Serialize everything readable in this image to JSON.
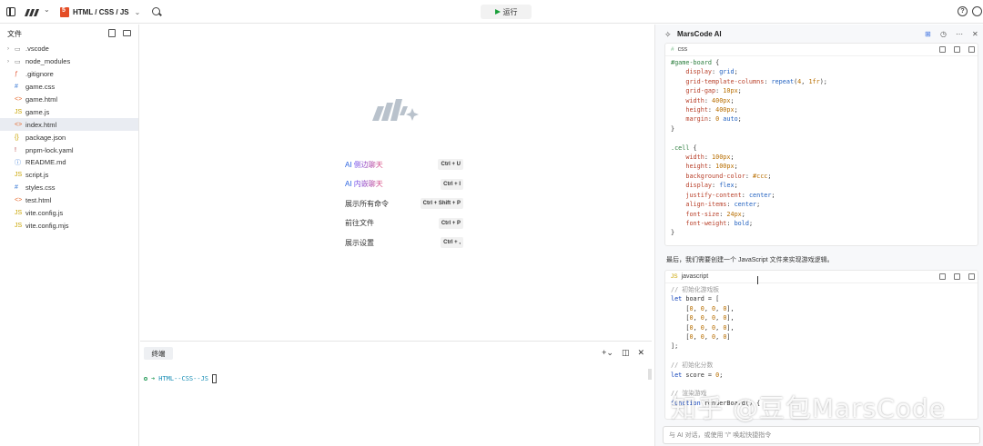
{
  "topbar": {
    "project_name": "HTML / CSS / JS",
    "run_label": "运行",
    "help_glyph": "?"
  },
  "explorer": {
    "title": "文件",
    "items": [
      {
        "name": ".vscode",
        "type": "folder",
        "icon": "folder-icon"
      },
      {
        "name": "node_modules",
        "type": "folder",
        "icon": "folder-icon"
      },
      {
        "name": ".gitignore",
        "type": "file",
        "glyph": "ƒ",
        "color": "#e45b3a"
      },
      {
        "name": "game.css",
        "type": "file",
        "glyph": "#",
        "color": "#3a7bd5"
      },
      {
        "name": "game.html",
        "type": "file",
        "glyph": "<>",
        "color": "#e66b2f"
      },
      {
        "name": "game.js",
        "type": "file",
        "glyph": "JS",
        "color": "#c9a400"
      },
      {
        "name": "index.html",
        "type": "file",
        "glyph": "<>",
        "color": "#e66b2f",
        "active": true
      },
      {
        "name": "package.json",
        "type": "file",
        "glyph": "{}",
        "color": "#c9a400"
      },
      {
        "name": "pnpm-lock.yaml",
        "type": "file",
        "glyph": "!",
        "color": "#b03030"
      },
      {
        "name": "README.md",
        "type": "file",
        "glyph": "ⓘ",
        "color": "#3a7bd5"
      },
      {
        "name": "script.js",
        "type": "file",
        "glyph": "JS",
        "color": "#c9a400"
      },
      {
        "name": "styles.css",
        "type": "file",
        "glyph": "#",
        "color": "#3a7bd5"
      },
      {
        "name": "test.html",
        "type": "file",
        "glyph": "<>",
        "color": "#e66b2f"
      },
      {
        "name": "vite.config.js",
        "type": "file",
        "glyph": "JS",
        "color": "#c9a400"
      },
      {
        "name": "vite.config.mjs",
        "type": "file",
        "glyph": "JS",
        "color": "#c9a400"
      }
    ]
  },
  "shortcuts": [
    {
      "label_prefix": "AI ",
      "label_rest": "侧边聊天",
      "keys": "Ctrl + U"
    },
    {
      "label_prefix": "AI ",
      "label_rest": "内嵌聊天",
      "keys": "Ctrl + I"
    },
    {
      "label_prefix": "",
      "label_rest": "展示所有命令",
      "keys": "Ctrl + Shift + P"
    },
    {
      "label_prefix": "",
      "label_rest": "前往文件",
      "keys": "Ctrl + P"
    },
    {
      "label_prefix": "",
      "label_rest": "展示设置",
      "keys": "Ctrl + ,"
    }
  ],
  "terminal": {
    "tab_label": "终端",
    "prompt_dir": "HTML--CSS--JS"
  },
  "ai_panel": {
    "title": "MarsCode AI",
    "css_card": {
      "lang": "css",
      "code": [
        [
          [
            "#game-board",
            "sel"
          ],
          [
            " {",
            ""
          ]
        ],
        [
          [
            "    display",
            "prop"
          ],
          [
            ": ",
            ""
          ],
          [
            "grid",
            "val"
          ],
          [
            ";",
            ""
          ]
        ],
        [
          [
            "    grid-template-columns",
            "prop"
          ],
          [
            ": ",
            ""
          ],
          [
            "repeat",
            "val"
          ],
          [
            "(",
            ""
          ],
          [
            "4",
            "num"
          ],
          [
            ", ",
            ""
          ],
          [
            "1fr",
            "num"
          ],
          [
            ");",
            ""
          ]
        ],
        [
          [
            "    grid-gap",
            "prop"
          ],
          [
            ": ",
            ""
          ],
          [
            "10px",
            "num"
          ],
          [
            ";",
            ""
          ]
        ],
        [
          [
            "    width",
            "prop"
          ],
          [
            ": ",
            ""
          ],
          [
            "400px",
            "num"
          ],
          [
            ";",
            ""
          ]
        ],
        [
          [
            "    height",
            "prop"
          ],
          [
            ": ",
            ""
          ],
          [
            "400px",
            "num"
          ],
          [
            ";",
            ""
          ]
        ],
        [
          [
            "    margin",
            "prop"
          ],
          [
            ": ",
            ""
          ],
          [
            "0",
            "num"
          ],
          [
            " ",
            ""
          ],
          [
            "auto",
            "val"
          ],
          [
            ";",
            ""
          ]
        ],
        [
          [
            "}",
            ""
          ]
        ],
        [
          [
            "",
            ""
          ]
        ],
        [
          [
            ".cell",
            "sel"
          ],
          [
            " {",
            ""
          ]
        ],
        [
          [
            "    width",
            "prop"
          ],
          [
            ": ",
            ""
          ],
          [
            "100px",
            "num"
          ],
          [
            ";",
            ""
          ]
        ],
        [
          [
            "    height",
            "prop"
          ],
          [
            ": ",
            ""
          ],
          [
            "100px",
            "num"
          ],
          [
            ";",
            ""
          ]
        ],
        [
          [
            "    background-color",
            "prop"
          ],
          [
            ": ",
            ""
          ],
          [
            "#ccc",
            "num"
          ],
          [
            ";",
            ""
          ]
        ],
        [
          [
            "    display",
            "prop"
          ],
          [
            ": ",
            ""
          ],
          [
            "flex",
            "val"
          ],
          [
            ";",
            ""
          ]
        ],
        [
          [
            "    justify-content",
            "prop"
          ],
          [
            ": ",
            ""
          ],
          [
            "center",
            "val"
          ],
          [
            ";",
            ""
          ]
        ],
        [
          [
            "    align-items",
            "prop"
          ],
          [
            ": ",
            ""
          ],
          [
            "center",
            "val"
          ],
          [
            ";",
            ""
          ]
        ],
        [
          [
            "    font-size",
            "prop"
          ],
          [
            ": ",
            ""
          ],
          [
            "24px",
            "num"
          ],
          [
            ";",
            ""
          ]
        ],
        [
          [
            "    font-weight",
            "prop"
          ],
          [
            ": ",
            ""
          ],
          [
            "bold",
            "val"
          ],
          [
            ";",
            ""
          ]
        ],
        [
          [
            "}",
            ""
          ]
        ]
      ]
    },
    "message": "最后，我们需要创建一个 JavaScript 文件来实现游戏逻辑。",
    "js_card": {
      "lang": "javascript",
      "code": [
        [
          [
            "// 初始化游戏板",
            "com"
          ]
        ],
        [
          [
            "let",
            "kw"
          ],
          [
            " board = [",
            ""
          ]
        ],
        [
          [
            "    [",
            ""
          ],
          [
            "0",
            "num"
          ],
          [
            ", ",
            ""
          ],
          [
            "0",
            "num"
          ],
          [
            ", ",
            ""
          ],
          [
            "0",
            "num"
          ],
          [
            ", ",
            ""
          ],
          [
            "0",
            "num"
          ],
          [
            "],",
            ""
          ]
        ],
        [
          [
            "    [",
            ""
          ],
          [
            "0",
            "num"
          ],
          [
            ", ",
            ""
          ],
          [
            "0",
            "num"
          ],
          [
            ", ",
            ""
          ],
          [
            "0",
            "num"
          ],
          [
            ", ",
            ""
          ],
          [
            "0",
            "num"
          ],
          [
            "],",
            ""
          ]
        ],
        [
          [
            "    [",
            ""
          ],
          [
            "0",
            "num"
          ],
          [
            ", ",
            ""
          ],
          [
            "0",
            "num"
          ],
          [
            ", ",
            ""
          ],
          [
            "0",
            "num"
          ],
          [
            ", ",
            ""
          ],
          [
            "0",
            "num"
          ],
          [
            "],",
            ""
          ]
        ],
        [
          [
            "    [",
            ""
          ],
          [
            "0",
            "num"
          ],
          [
            ", ",
            ""
          ],
          [
            "0",
            "num"
          ],
          [
            ", ",
            ""
          ],
          [
            "0",
            "num"
          ],
          [
            ", ",
            ""
          ],
          [
            "0",
            "num"
          ],
          [
            "]",
            ""
          ]
        ],
        [
          [
            "];",
            ""
          ]
        ],
        [
          [
            "",
            ""
          ]
        ],
        [
          [
            "// 初始化分数",
            "com"
          ]
        ],
        [
          [
            "let",
            "kw"
          ],
          [
            " score = ",
            ""
          ],
          [
            "0",
            "num"
          ],
          [
            ";",
            ""
          ]
        ],
        [
          [
            "",
            ""
          ]
        ],
        [
          [
            "// 渲染游戏",
            "com"
          ]
        ],
        [
          [
            "function",
            "kw"
          ],
          [
            " renderBoard() {",
            ""
          ]
        ]
      ]
    },
    "input_placeholder": "与 AI 对话，或使用 \"/\" 唤起快捷指令",
    "watermark": "知乎 @豆包MarsCode"
  }
}
